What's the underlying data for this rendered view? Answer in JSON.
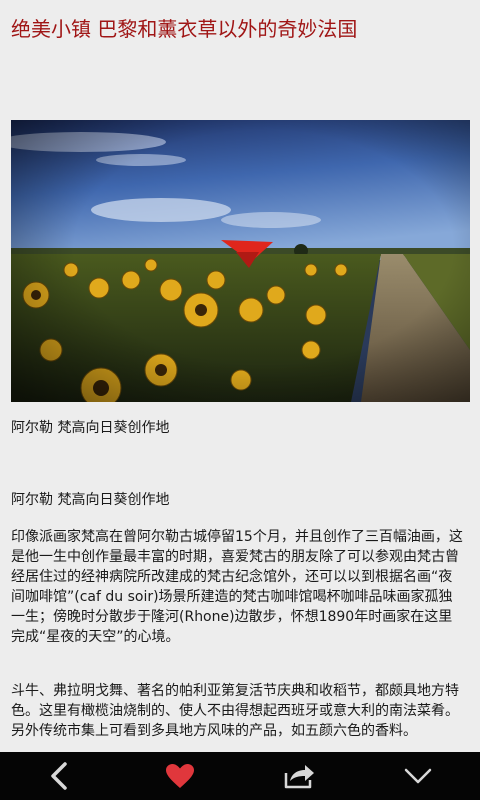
{
  "article": {
    "title": "绝美小镇 巴黎和薰衣草以外的奇妙法国",
    "image_caption": "阿尔勒 梵高向日葵创作地",
    "subheading": "阿尔勒 梵高向日葵创作地",
    "paragraphs": [
      "印像派画家梵高在曾阿尔勒古城停留15个月，并且创作了三百幅油画，这是他一生中创作量最丰富的时期，喜爱梵古的朋友除了可以参观由梵古曾经居住过的经神病院所改建成的梵古纪念馆外，还可以以到根据名画“夜间咖啡馆”(caf du soir)场景所建造的梵古咖啡馆喝杯咖啡品味画家孤独一生；傍晚时分散步于隆河(Rhone)边散步，怀想1890年时画家在这里完成“星夜的天空”的心境。",
      "斗牛、弗拉明戈舞、著名的帕利亚第复活节庆典和收稻节，都颇具地方特色。这里有橄榄油烧制的、使人不由得想起西班牙或意大利的南法菜肴。另外传统市集上可看到多具地方风味的产品，如五颜六色的香料。"
    ]
  },
  "toolbar": {
    "back_icon": "chevron-left-icon",
    "favorite_icon": "heart-icon",
    "share_icon": "share-icon",
    "more_icon": "chevron-down-icon",
    "favorite_color": "#e0373c",
    "icon_color": "#d8d8d8"
  }
}
